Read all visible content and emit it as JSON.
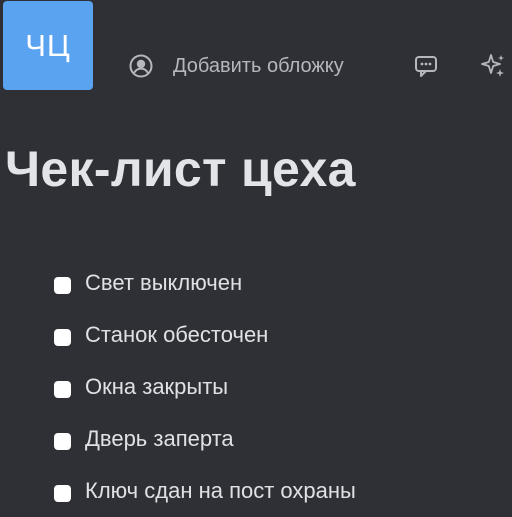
{
  "page": {
    "icon_text": "ЧЦ",
    "add_cover_label": "Добавить обложку",
    "title": "Чек-лист цеха"
  },
  "toolbar": {
    "icons": [
      "user-circle-icon",
      "comments-icon",
      "sparkles-icon"
    ]
  },
  "checklist": {
    "items": [
      {
        "label": "Свет выключен",
        "checked": false
      },
      {
        "label": "Станок обесточен",
        "checked": false
      },
      {
        "label": "Окна закрыты",
        "checked": false
      },
      {
        "label": "Дверь заперта",
        "checked": false
      },
      {
        "label": "Ключ сдан на пост охраны",
        "checked": false
      }
    ]
  },
  "colors": {
    "background": "#2f3035",
    "page_icon_bg": "#5aa3f0",
    "text": "#e2e3e7",
    "muted_text": "#b5b7bd",
    "checkbox": "#ffffff"
  }
}
